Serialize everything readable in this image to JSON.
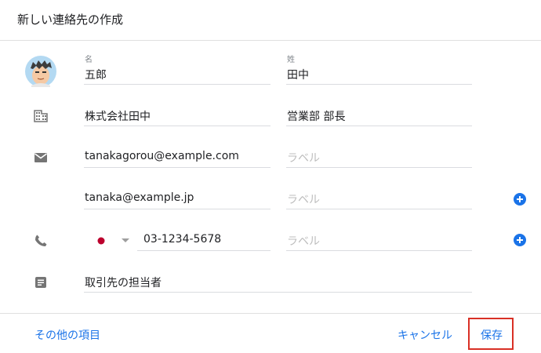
{
  "dialog": {
    "title": "新しい連絡先の作成"
  },
  "name": {
    "first_label": "名",
    "first_value": "五郎",
    "last_label": "姓",
    "last_value": "田中"
  },
  "company": {
    "company_value": "株式会社田中",
    "title_value": "営業部 部長",
    "icon": "building-icon"
  },
  "emails": [
    {
      "value": "tanakagorou@example.com",
      "label_placeholder": "ラベル"
    },
    {
      "value": "tanaka@example.jp",
      "label_placeholder": "ラベル"
    }
  ],
  "phone": {
    "country_flag": "jp-flag",
    "value": "03-1234-5678",
    "label_placeholder": "ラベル"
  },
  "notes": {
    "value": "取引先の担当者"
  },
  "footer": {
    "more_fields": "その他の項目",
    "cancel": "キャンセル",
    "save": "保存"
  },
  "colors": {
    "accent": "#1a73e8",
    "highlight_border": "#d93025",
    "icon_gray": "#757575",
    "divider": "#e0e0e0"
  }
}
